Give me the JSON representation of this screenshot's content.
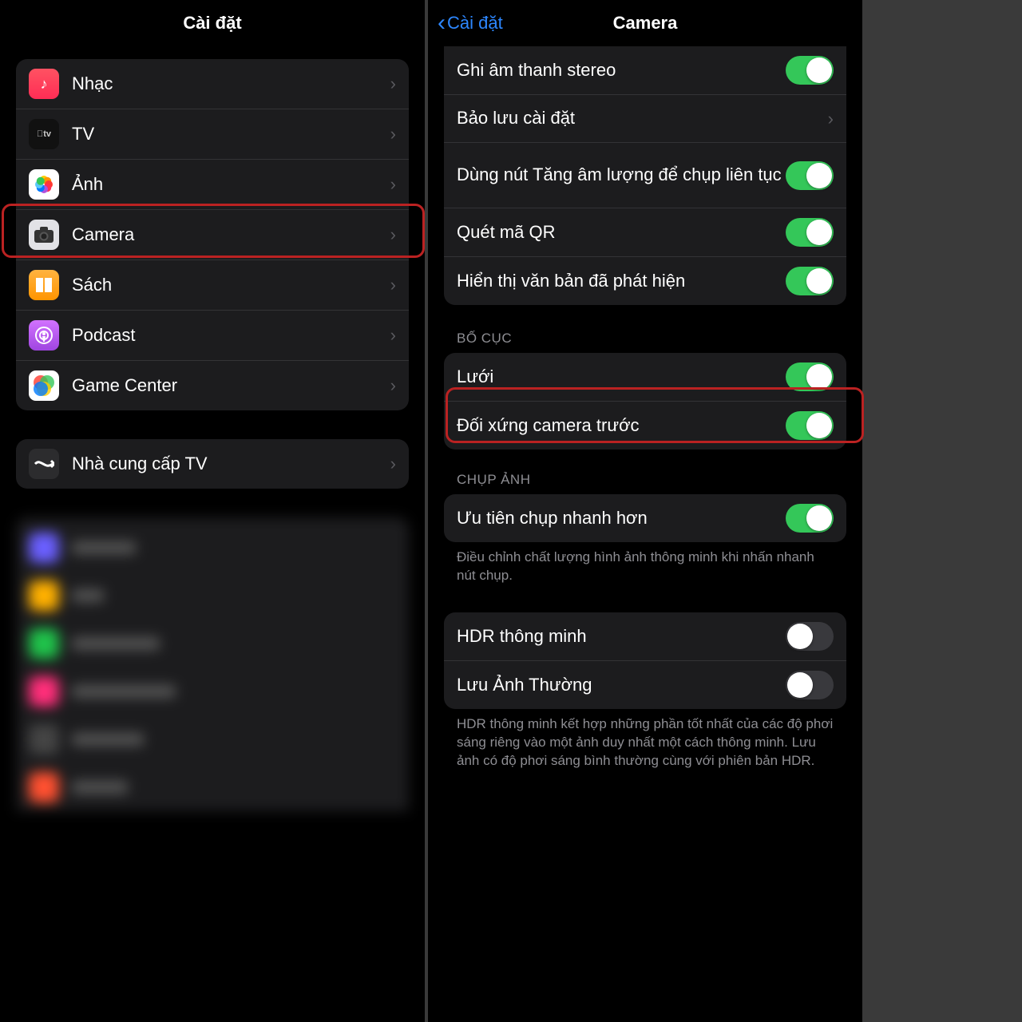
{
  "left": {
    "title": "Cài đặt",
    "items": [
      {
        "label": "Nhạc",
        "icon": "music"
      },
      {
        "label": "TV",
        "icon": "tv"
      },
      {
        "label": "Ảnh",
        "icon": "photos"
      },
      {
        "label": "Camera",
        "icon": "camera"
      },
      {
        "label": "Sách",
        "icon": "books"
      },
      {
        "label": "Podcast",
        "icon": "podcast"
      },
      {
        "label": "Game Center",
        "icon": "gamecenter"
      }
    ],
    "tvProvider": {
      "label": "Nhà cung cấp TV"
    }
  },
  "right": {
    "back": "Cài đặt",
    "title": "Camera",
    "group1": [
      {
        "label": "Ghi âm thanh stereo",
        "type": "toggle",
        "on": true
      },
      {
        "label": "Bảo lưu cài đặt",
        "type": "link"
      },
      {
        "label": "Dùng nút Tăng âm lượng để chụp liên tục",
        "type": "toggle",
        "on": true
      },
      {
        "label": "Quét mã QR",
        "type": "toggle",
        "on": true
      },
      {
        "label": "Hiển thị văn bản đã phát hiện",
        "type": "toggle",
        "on": true
      }
    ],
    "secLayout": "BỐ CỤC",
    "layout": [
      {
        "label": "Lưới",
        "on": true
      },
      {
        "label": "Đối xứng camera trước",
        "on": true
      }
    ],
    "secCapture": "CHỤP ẢNH",
    "capture": [
      {
        "label": "Ưu tiên chụp nhanh hơn",
        "on": true
      }
    ],
    "captureFooter": "Điều chỉnh chất lượng hình ảnh thông minh khi nhấn nhanh nút chụp.",
    "hdr": [
      {
        "label": "HDR thông minh",
        "on": false
      },
      {
        "label": "Lưu Ảnh Thường",
        "on": false
      }
    ],
    "hdrFooter": "HDR thông minh kết hợp những phần tốt nhất của các độ phơi sáng riêng vào một ảnh duy nhất một cách thông minh. Lưu ảnh có độ phơi sáng bình thường cùng với phiên bản HDR."
  }
}
